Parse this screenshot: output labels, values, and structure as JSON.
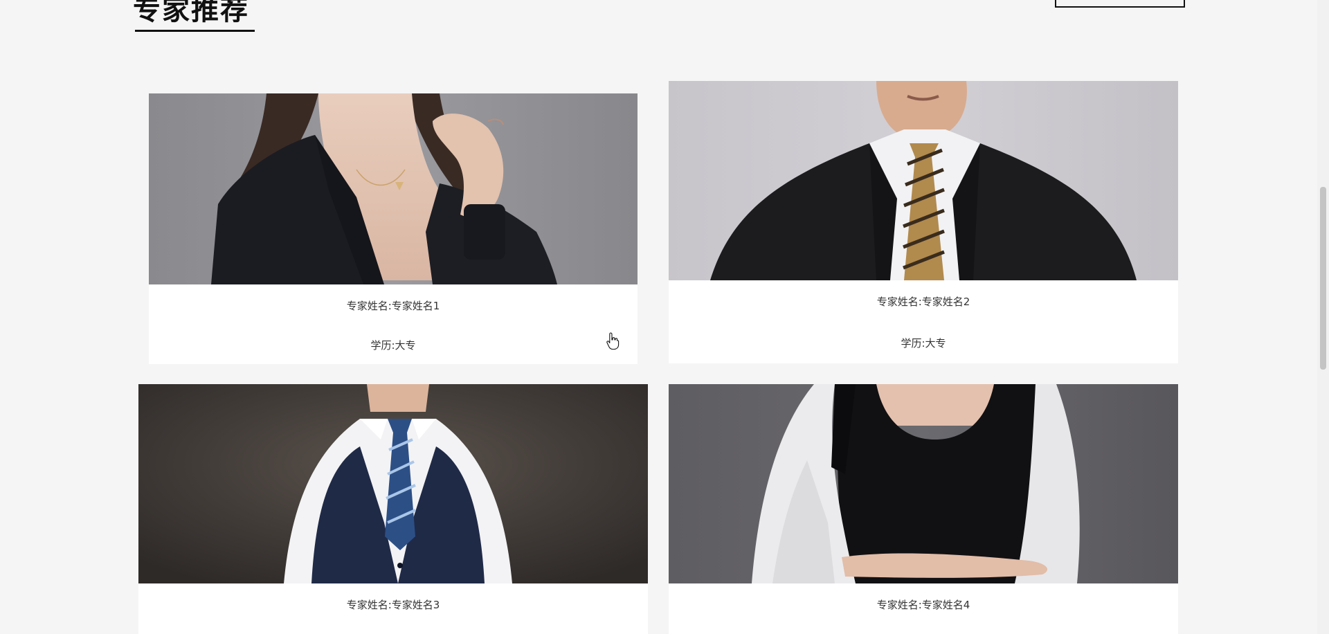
{
  "section": {
    "title": "专家推荐",
    "more_button_label": ""
  },
  "experts": [
    {
      "name_label": "专家姓名:",
      "name": "专家姓名1",
      "edu_label": "学历:",
      "education": "大专",
      "photo": "woman-dark-blazer-photo"
    },
    {
      "name_label": "专家姓名:",
      "name": "专家姓名2",
      "edu_label": "学历:",
      "education": "大专",
      "photo": "man-suit-striped-tie-photo"
    },
    {
      "name_label": "专家姓名:",
      "name": "专家姓名3",
      "photo": "man-navy-vest-photo"
    },
    {
      "name_label": "专家姓名:",
      "name": "专家姓名4",
      "photo": "woman-white-jacket-photo"
    }
  ],
  "icons": {
    "cursor": "hand-pointer-icon"
  },
  "colors": {
    "page_background": "#f5f5f5",
    "card_background": "#ffffff",
    "title_text": "#111111",
    "body_text": "#333333"
  }
}
